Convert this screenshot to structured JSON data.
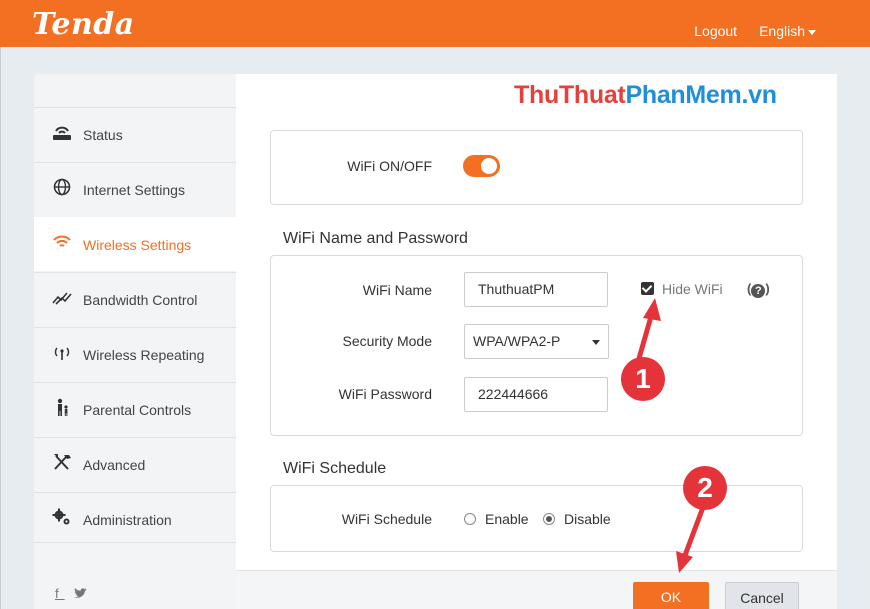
{
  "header": {
    "logo": "Tenda",
    "logout": "Logout",
    "language": "English"
  },
  "watermark": {
    "part1": "ThuThuat",
    "part2": "PhanMem.vn"
  },
  "sidebar": {
    "items": [
      {
        "label": "Status",
        "icon": "router-icon"
      },
      {
        "label": "Internet Settings",
        "icon": "globe-icon"
      },
      {
        "label": "Wireless Settings",
        "icon": "wifi-icon"
      },
      {
        "label": "Bandwidth Control",
        "icon": "bandwidth-icon"
      },
      {
        "label": "Wireless Repeating",
        "icon": "repeater-icon"
      },
      {
        "label": "Parental Controls",
        "icon": "parent-child-icon"
      },
      {
        "label": "Advanced",
        "icon": "tools-icon"
      },
      {
        "label": "Administration",
        "icon": "gears-icon"
      }
    ],
    "social": "f 𝕏"
  },
  "wifi_toggle": {
    "label": "WiFi ON/OFF",
    "state": "on"
  },
  "name_password": {
    "title": "WiFi Name and Password",
    "name_label": "WiFi Name",
    "name_value": "ThuthuatPM",
    "hide_label": "Hide WiFi",
    "hide_checked": true,
    "help": "(❓)",
    "security_label": "Security Mode",
    "security_value": "WPA/WPA2-P",
    "password_label": "WiFi Password",
    "password_value": "222444666"
  },
  "schedule": {
    "title": "WiFi Schedule",
    "label": "WiFi Schedule",
    "enable": "Enable",
    "disable": "Disable",
    "selected": "Disable"
  },
  "buttons": {
    "ok": "OK",
    "cancel": "Cancel"
  },
  "annotations": {
    "badge1": "1",
    "badge2": "2"
  },
  "colors": {
    "brand": "#f36f21",
    "annotation": "#e5333a"
  }
}
